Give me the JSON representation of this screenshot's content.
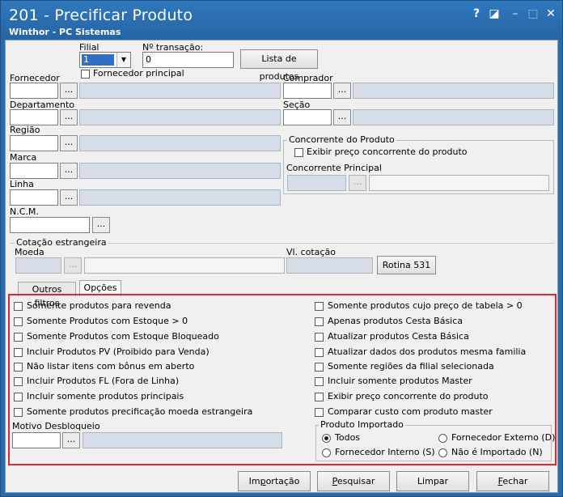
{
  "window": {
    "title": "201 - Precificar Produto",
    "subtitle": "Winthor - PC Sistemas",
    "controls": [
      "?",
      "◪",
      "–",
      "□",
      "✕"
    ]
  },
  "header": {
    "filial_label": "Filial",
    "filial_value": "1",
    "transacao_label": "Nº transação:",
    "transacao_value": "0",
    "lista_button": "Lista de produtos",
    "fornecedor_principal_label": "Fornecedor principal"
  },
  "fields": {
    "fornecedor": "Fornecedor",
    "departamento": "Departamento",
    "regiao": "Região",
    "marca": "Marca",
    "linha": "Linha",
    "ncm": "N.C.M.",
    "comprador": "Comprador",
    "secao": "Seção",
    "dots": "..."
  },
  "concorrente": {
    "group_title": "Concorrente do Produto",
    "exibir_label": "Exibir preço concorrente do produto",
    "principal_label": "Concorrente Principal"
  },
  "cotacao": {
    "group_title": "Cotação estrangeira",
    "moeda_label": "Moeda",
    "vl_label": "Vl. cotação",
    "rotina_button": "Rotina 531"
  },
  "tabs": [
    {
      "label": "Outros filtros"
    },
    {
      "label": "Opções"
    }
  ],
  "options_left": [
    "Somente produtos para revenda",
    "Somente Produtos com Estoque > 0",
    "Somente Produtos com Estoque Bloqueado",
    "Incluir Produtos PV (Proibido para Venda)",
    "Não listar itens com bônus em aberto",
    "Incluir Produtos FL (Fora de Linha)",
    "Incluir somente produtos principais",
    "Somente produtos precificação moeda estrangeira"
  ],
  "options_right": [
    "Somente produtos cujo preço de tabela > 0",
    "Apenas produtos Cesta Básica",
    "Atualizar produtos Cesta Básica",
    "Atualizar dados dos produtos mesma familia",
    "Somente regiões da filial selecionada",
    "Incluir somente produtos Master",
    "Exibir preço concorrente do produto",
    "Comparar custo com produto master"
  ],
  "motivo_label": "Motivo Desbloqueio",
  "produto_importado": {
    "title": "Produto Importado",
    "todos": "Todos",
    "fornecedor_externo": "Fornecedor Externo (D)",
    "fornecedor_interno": "Fornecedor Interno (S)",
    "nao_importado": "Não é Importado (N)",
    "selected": "Todos"
  },
  "footer": {
    "importacao": [
      "Im",
      "p",
      "ortação"
    ],
    "pesquisar": [
      "",
      "P",
      "esquisar"
    ],
    "limpar": [
      "",
      "",
      "Limpar"
    ],
    "fechar": [
      "",
      "F",
      "echar"
    ]
  },
  "colors": {
    "titlebar": "#2a6aa8",
    "highlight": "#e2262b",
    "readonly_field": "#d6dde6"
  }
}
